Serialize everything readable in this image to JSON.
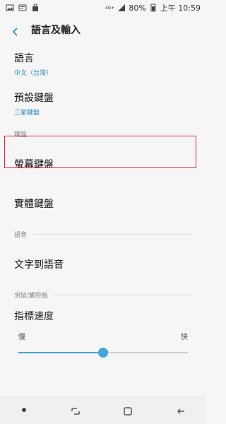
{
  "status": {
    "battery_text": "80%",
    "time_text": "上午 10:59",
    "network_badge": "4G+"
  },
  "header": {
    "title": "語言及輸入"
  },
  "items": {
    "language": {
      "main": "語言",
      "sub": "中文（台灣）"
    },
    "default_keyboard": {
      "main": "預設鍵盤",
      "sub": "三星鍵盤"
    }
  },
  "sections": {
    "keyboard": "鍵盤",
    "speech": "語音",
    "mouse_touchpad": "滑鼠/觸控板"
  },
  "keyboard_items": {
    "screen_keyboard": "螢幕鍵盤",
    "physical_keyboard": "實體鍵盤"
  },
  "speech_items": {
    "tts": "文字到語音"
  },
  "pointer": {
    "title": "指標速度",
    "slow_label": "慢",
    "fast_label": "快",
    "level": 0.5
  },
  "colors": {
    "accent": "#41a6d9",
    "highlight": "#d9292e"
  }
}
